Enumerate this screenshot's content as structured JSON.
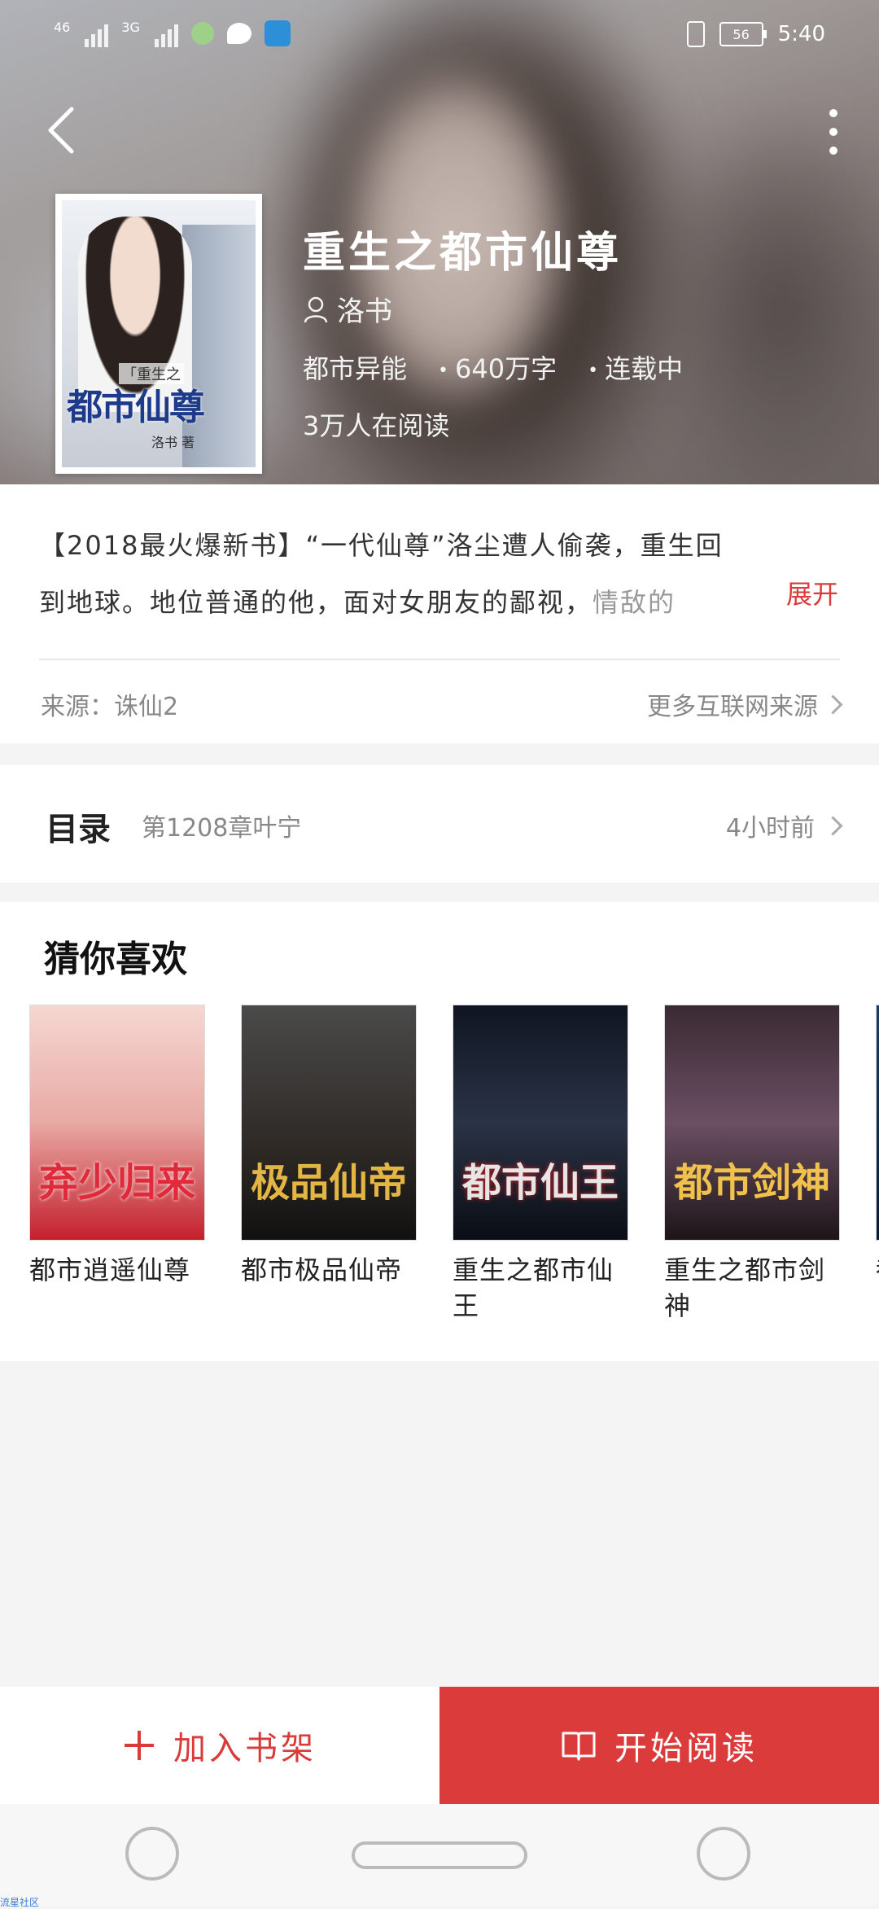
{
  "status_bar": {
    "network1": "46",
    "network2": "3G",
    "battery": "56",
    "time": "5:40"
  },
  "book": {
    "title": "重生之都市仙尊",
    "author": "洛书",
    "category": "都市异能",
    "word_count": "640万字",
    "status": "连载中",
    "readers": "3万人在阅读",
    "cover": {
      "subtitle": "「重生之",
      "title": "都市仙尊",
      "author": "洛书 著"
    }
  },
  "description": {
    "line1": "【2018最火爆新书】“一代仙尊”洛尘遭人偷袭，重生回",
    "line2": "到地球。地位普通的他，面对女朋友的鄙视，",
    "line2_fade": "情敌的",
    "expand_label": "展开",
    "source_label": "来源：诛仙2",
    "more_sources_label": "更多互联网来源"
  },
  "toc": {
    "label": "目录",
    "latest_chapter": "第1208章叶宁",
    "updated": "4小时前"
  },
  "recommendations": {
    "heading": "猜你喜欢",
    "books": [
      {
        "title": "都市逍遥仙尊",
        "cover_text": "弃少归来"
      },
      {
        "title": "都市极品仙帝",
        "cover_text": "极品仙帝"
      },
      {
        "title": "重生之都市仙王",
        "cover_text": "都市仙王"
      },
      {
        "title": "重生之都市剑神",
        "cover_text": "都市剑神"
      },
      {
        "title": "都",
        "cover_text": ""
      }
    ]
  },
  "actions": {
    "add_to_shelf": "加入书架",
    "start_reading": "开始阅读"
  },
  "watermark": "流星社区",
  "colors": {
    "accent": "#db3b3b",
    "text_muted": "#888888"
  }
}
